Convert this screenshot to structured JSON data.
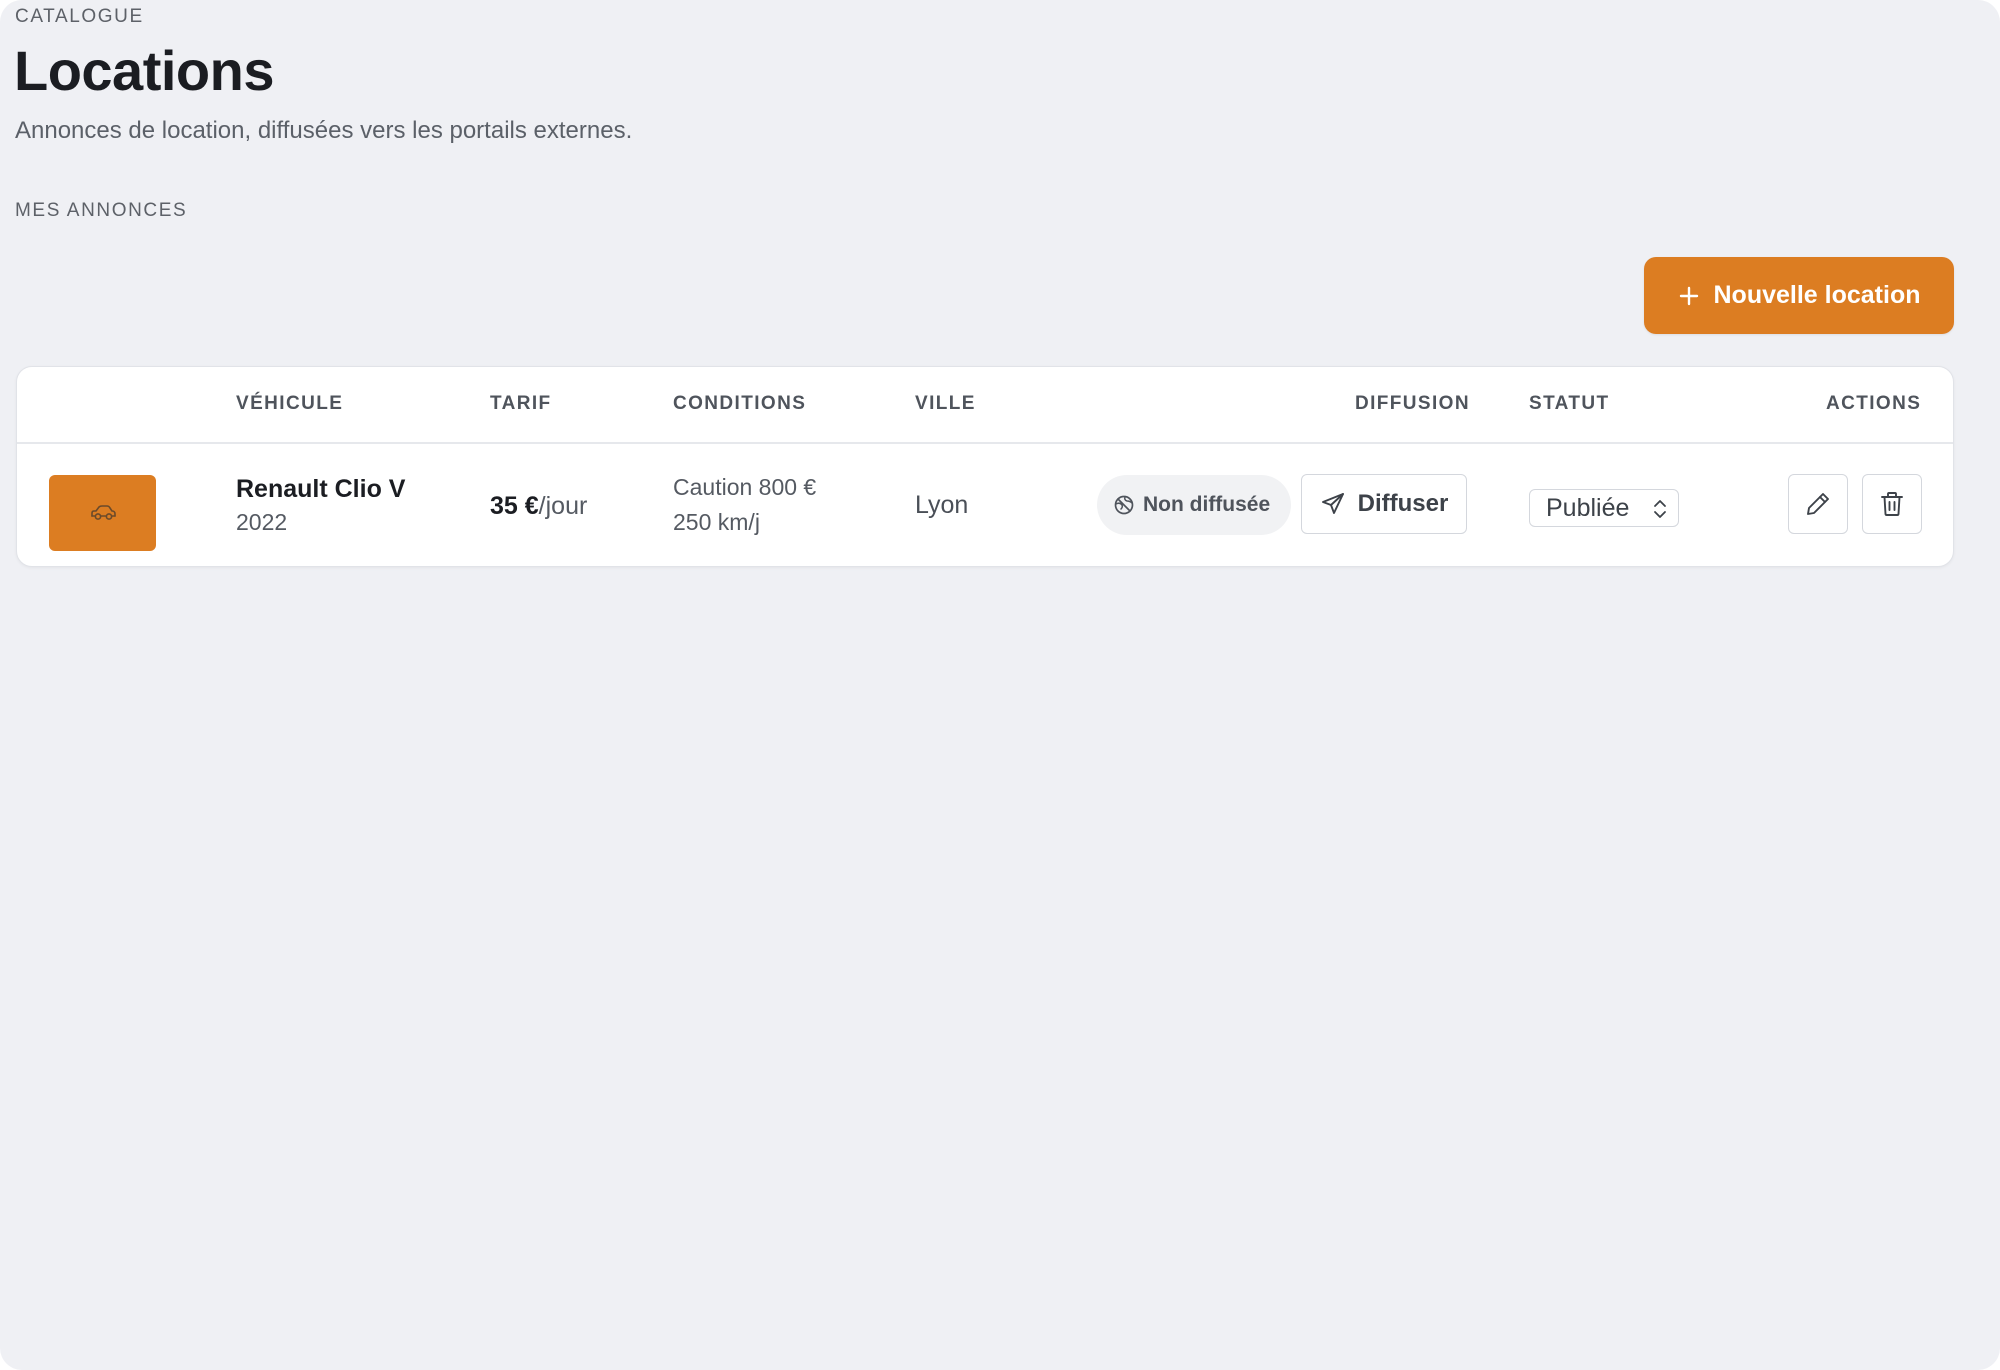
{
  "header": {
    "eyebrow": "CATALOGUE",
    "title": "Locations",
    "subtitle": "Annonces de location, diffusées vers les portails externes."
  },
  "section": {
    "label": "MES ANNONCES"
  },
  "toolbar": {
    "new_label": "Nouvelle location"
  },
  "table": {
    "columns": {
      "vehicle": "VÉHICULE",
      "tarif": "TARIF",
      "conditions": "CONDITIONS",
      "ville": "VILLE",
      "diffusion": "DIFFUSION",
      "statut": "STATUT",
      "actions": "ACTIONS"
    },
    "rows": [
      {
        "vehicle_name": "Renault Clio V",
        "year": "2022",
        "price": "35 €",
        "price_unit": "/jour",
        "condition_deposit": "Caution 800 €",
        "condition_mileage": "250 km/j",
        "city": "Lyon",
        "diffusion_badge": "Non diffusée",
        "diffuse_label": "Diffuser",
        "status": "Publiée"
      }
    ]
  },
  "colors": {
    "accent": "#dc7d22",
    "background": "#eff0f4",
    "card": "#ffffff"
  },
  "icons": {
    "new": "plus-icon",
    "thumbnail": "car-icon",
    "badge": "globe-off-icon",
    "diffuse": "send-icon",
    "status": "chevron-up-down-icon",
    "edit": "pencil-icon",
    "delete": "trash-icon"
  }
}
